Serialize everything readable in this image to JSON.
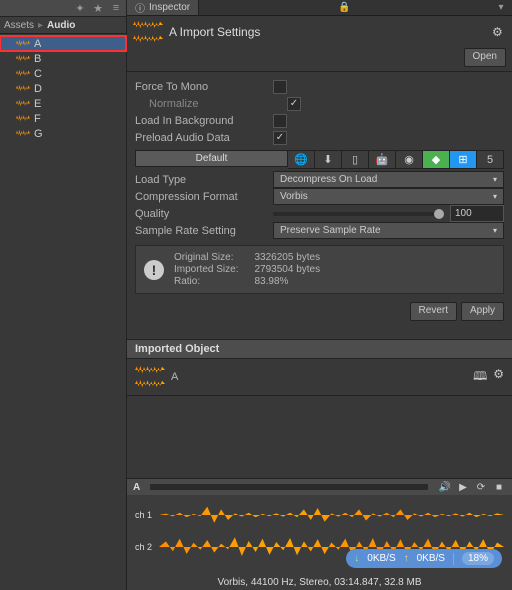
{
  "breadcrumb": {
    "root": "Assets",
    "folder": "Audio"
  },
  "tree": {
    "items": [
      "A",
      "B",
      "C",
      "D",
      "E",
      "F",
      "G"
    ]
  },
  "inspector_tab": "Inspector",
  "header": {
    "title": "A Import Settings",
    "open": "Open"
  },
  "settings": {
    "force_to_mono": "Force To Mono",
    "normalize": "Normalize",
    "load_bg": "Load In Background",
    "preload": "Preload Audio Data",
    "default": "Default",
    "load_type_lbl": "Load Type",
    "load_type_val": "Decompress On Load",
    "comp_fmt_lbl": "Compression Format",
    "comp_fmt_val": "Vorbis",
    "quality_lbl": "Quality",
    "quality_val": "100",
    "sample_rate_lbl": "Sample Rate Setting",
    "sample_rate_val": "Preserve Sample Rate"
  },
  "info": {
    "orig_size_lbl": "Original Size:",
    "orig_size_val": "3326205 bytes",
    "imp_size_lbl": "Imported Size:",
    "imp_size_val": "2793504 bytes",
    "ratio_lbl": "Ratio:",
    "ratio_val": "83.98%"
  },
  "buttons": {
    "revert": "Revert",
    "apply": "Apply"
  },
  "imported_object": "Imported Object",
  "preview": {
    "name": "A"
  },
  "transport": {
    "label": "A"
  },
  "channels": {
    "ch1": "ch 1",
    "ch2": "ch 2"
  },
  "footer": "Vorbis, 44100 Hz, Stereo, 03:14.847, 32.8 MB",
  "overlay": {
    "down": "0KB/S",
    "up": "0KB/S",
    "pct": "18%"
  }
}
